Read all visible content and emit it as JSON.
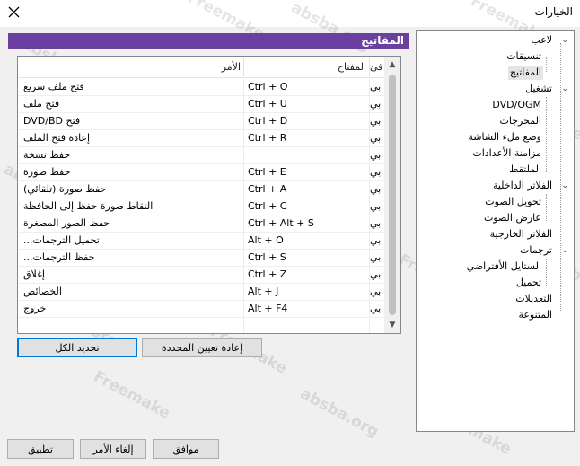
{
  "window": {
    "title": "الخيارات"
  },
  "section_header": "المفاتيح",
  "table": {
    "columns": {
      "command": "الأمر",
      "key": "المفتاح",
      "category": "فئ"
    },
    "rows": [
      {
        "command": "فتح ملف سريع",
        "key": "Ctrl + O",
        "category": "بي"
      },
      {
        "command": "فتح ملف",
        "key": "Ctrl + U",
        "category": "بي"
      },
      {
        "command": "فتح DVD/BD",
        "key": "Ctrl + D",
        "category": "بي"
      },
      {
        "command": "إعادة فتح الملف",
        "key": "Ctrl + R",
        "category": "بي"
      },
      {
        "command": "حفظ نسخة",
        "key": "",
        "category": "بي"
      },
      {
        "command": "حفظ صورة",
        "key": "Ctrl + E",
        "category": "بي"
      },
      {
        "command": "حفظ صورة (تلقائي)",
        "key": "Ctrl + A",
        "category": "بي"
      },
      {
        "command": "التقاط صورة حفظ إلى الحافظة",
        "key": "Ctrl + C",
        "category": "بي"
      },
      {
        "command": "حفظ الصور المصغرة",
        "key": "Ctrl + Alt + S",
        "category": "بي"
      },
      {
        "command": "تحميل الترجمات...",
        "key": "Alt + O",
        "category": "بي"
      },
      {
        "command": "حفظ الترجمات...",
        "key": "Ctrl + S",
        "category": "بي"
      },
      {
        "command": "إغلاق",
        "key": "Ctrl + Z",
        "category": "بي"
      },
      {
        "command": "الخصائص",
        "key": "Alt + J",
        "category": "بي"
      },
      {
        "command": "خروج",
        "key": "Alt + F4",
        "category": "بي"
      }
    ]
  },
  "buttons": {
    "select_all": "تحديد الكل",
    "reset_selected": "إعادة تعيين المحددة",
    "ok": "موافق",
    "cancel": "إلغاء الأمر",
    "apply": "تطبيق"
  },
  "tree": {
    "player": "لاعب",
    "formats": "تنسيقات",
    "keys": "المفاتيح",
    "playback": "تشغيل",
    "dvd_ogm": "DVD/OGM",
    "outputs": "المخرجات",
    "fullscreen": "وضع ملء الشاشة",
    "sync": "مزامنة الأعدادات",
    "capture": "الملتقط",
    "internal_filters": "الفلاتر الداخلية",
    "audio_switcher": "تحويل الصوت",
    "audio_renderer": "عارض الصوت",
    "external_filters": "الفلاتر الخارجية",
    "subtitles": "ترجمات",
    "default_style": "الستايل الأفتراضي",
    "load": "تحميل",
    "tweaks": "التعديلات",
    "misc": "المتنوعة"
  },
  "icons": {
    "close": "close-icon",
    "expand": "chevron-down-icon",
    "scroll_up": "arrow-up-icon",
    "scroll_down": "arrow-down-icon"
  },
  "colors": {
    "header_bg": "#6a3fa0",
    "default_button_border": "#0078d7",
    "selected_item_bg": "#e5e5e5"
  },
  "watermark": {
    "line1": "Freemake",
    "line2": "absba.org"
  }
}
